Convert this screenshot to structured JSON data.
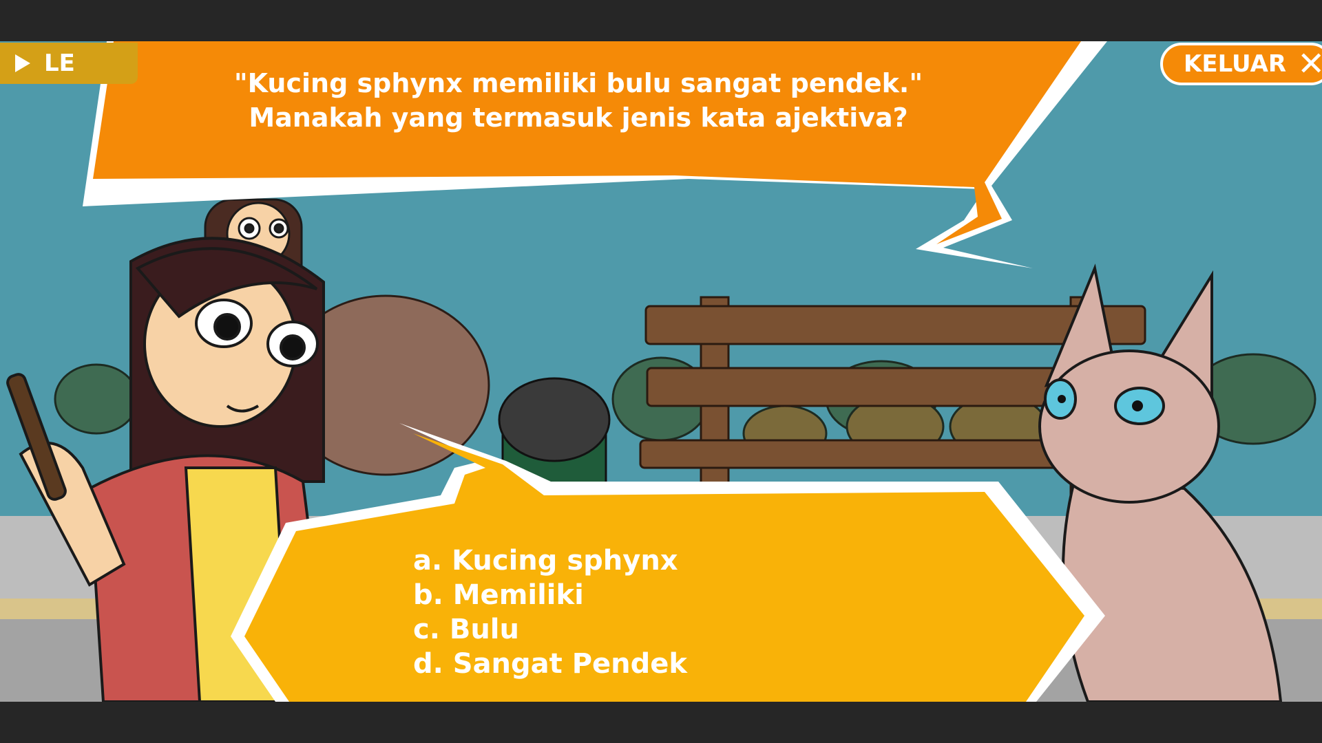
{
  "hud": {
    "level_label": "LE",
    "exit_label": "KELUAR",
    "exit_icon": "close-icon"
  },
  "question": {
    "line1": "\"Kucing sphynx memiliki bulu sangat pendek.\"",
    "line2": "Manakah yang termasuk jenis kata ajektiva?"
  },
  "answers": [
    "a. Kucing sphynx",
    "b. Memiliki",
    "c. Bulu",
    "d. Sangat Pendek"
  ],
  "colors": {
    "question_bubble": "#f58a07",
    "answer_bubble": "#f9b208",
    "sky": "#4f9aaa",
    "bench": "#7a5132",
    "exit_button": "#f58a07"
  }
}
